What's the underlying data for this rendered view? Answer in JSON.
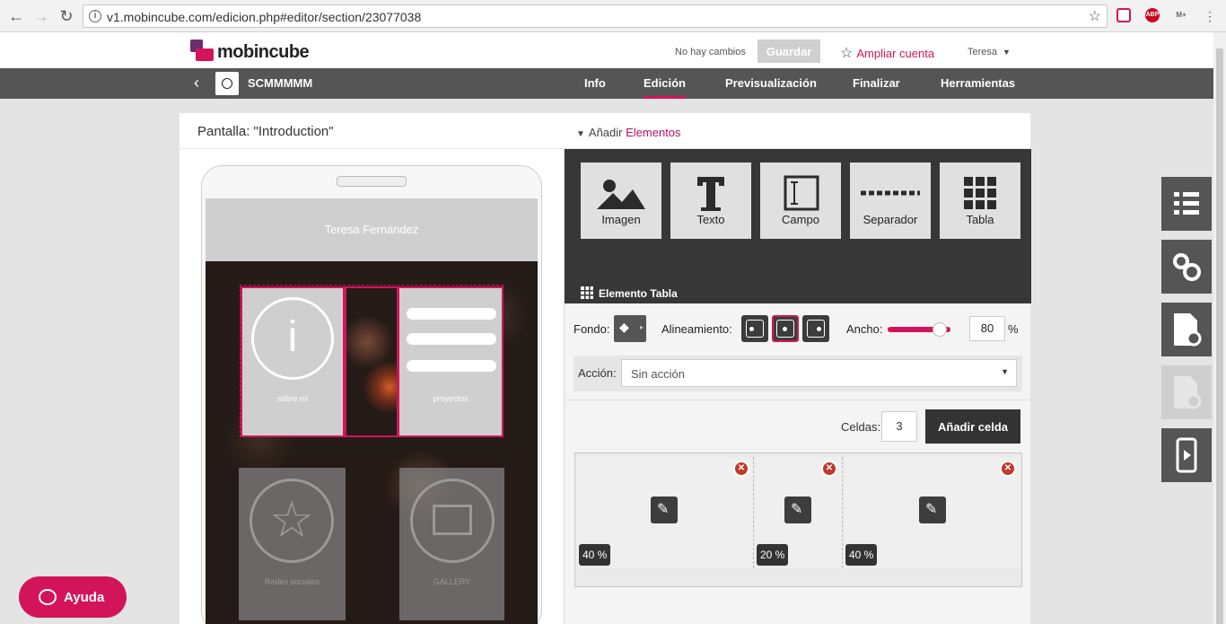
{
  "browser": {
    "url": "v1.mobincube.com/edicion.php#editor/section/23077038",
    "ext_abp": "ABP",
    "ext_m": "M+"
  },
  "header": {
    "logo": "mobincube",
    "status": "No hay cambios",
    "save_label": "Guardar",
    "upgrade_label": "Ampliar cuenta",
    "user": "Teresa"
  },
  "nav": {
    "app_name": "SCMMMMM",
    "tabs": [
      {
        "label": "Info",
        "active": false
      },
      {
        "label": "Edición",
        "active": true
      },
      {
        "label": "Previsualización",
        "active": false
      },
      {
        "label": "Finalizar",
        "active": false
      },
      {
        "label": "Herramientas",
        "active": false
      }
    ]
  },
  "screen": {
    "title": "Pantalla: \"Introduction\"",
    "add_prefix": "Añadir",
    "add_link": "Elementos"
  },
  "phone": {
    "header": "Teresa Fernández",
    "tiles": [
      {
        "label": "sobre mi",
        "icon": "info-icon"
      },
      {
        "label": "proyectos",
        "icon": "list-icon"
      },
      {
        "label": "Redes sociales",
        "icon": "star-icon"
      },
      {
        "label": "GALLERY",
        "icon": "image-icon"
      }
    ]
  },
  "palette": {
    "items": [
      {
        "label": "Imagen",
        "icon": "image-icon"
      },
      {
        "label": "Texto",
        "icon": "text-icon"
      },
      {
        "label": "Campo",
        "icon": "field-icon"
      },
      {
        "label": "Separador",
        "icon": "separator-icon"
      },
      {
        "label": "Tabla",
        "icon": "table-icon"
      }
    ],
    "section_title": "Elemento Tabla"
  },
  "props": {
    "fondo_label": "Fondo:",
    "align_label": "Alineamiento:",
    "align_selected": "center",
    "width_label": "Ancho:",
    "width_value": "80",
    "width_unit": "%",
    "width_fraction": 0.8,
    "action_label": "Acción:",
    "action_value": "Sin acción",
    "cells_label": "Celdas:",
    "cells_value": "3",
    "add_cell_label": "Añadir celda"
  },
  "cells": [
    {
      "percent": "40 %"
    },
    {
      "percent": "20 %"
    },
    {
      "percent": "40 %"
    }
  ],
  "help_label": "Ayuda",
  "colors": {
    "accent": "#d4145a",
    "dark": "#373737"
  }
}
